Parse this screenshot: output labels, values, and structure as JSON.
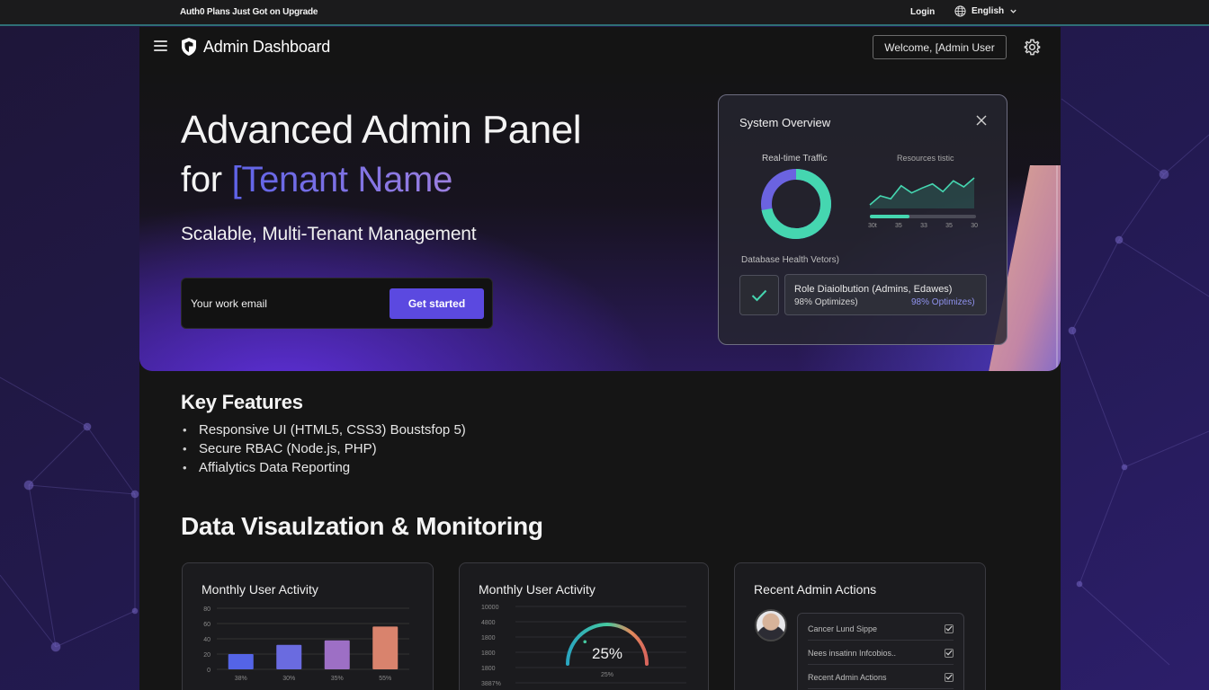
{
  "topbar": {
    "promo": "Auth0 Plans Just Got on Upgrade",
    "login": "Login",
    "language": "English",
    "icons": [
      "globe-icon",
      "chevron-down-icon"
    ]
  },
  "header": {
    "title": "Admin Dashboard",
    "welcome": "Welcome, [Admin User",
    "icons": [
      "hamburger-icon",
      "shield-logo-icon",
      "gear-icon"
    ]
  },
  "hero": {
    "title_line1": "Advanced Admin Panel",
    "title_prefix": "for ",
    "title_tenant": "[Tenant Name",
    "subtitle": "Scalable, Multi-Tenant Management",
    "email_placeholder": "Your work email",
    "cta": "Get started"
  },
  "overview": {
    "title": "System Overview",
    "traffic_label": "Real-time Traffic",
    "resources_label": "Resources tistic",
    "traffic_share": 0.72,
    "sparkline": [
      40,
      55,
      50,
      72,
      60,
      68,
      75,
      62,
      80,
      70,
      85
    ],
    "progress": 0.37,
    "ticks": [
      "30t",
      "35",
      "33",
      "35",
      "30"
    ],
    "db_label": "Database Health Vetors)",
    "role_title": "Role Diaiolbution (Admins, Edawes)",
    "role_stat_a": "98% Optimizes)",
    "role_stat_b": "98% Optimizes)",
    "accent": "#45d6b0",
    "donut_secondary": "#6b63e0"
  },
  "features": {
    "title": "Key Features",
    "items": [
      "Responsive UI (HTML5, CSS3) Boustsfop 5)",
      "Secure RBAC (Node.js, PHP)",
      "Affialytics Data Reporting"
    ]
  },
  "dataviz": {
    "title": "Data Visaulzation & Monitoring"
  },
  "cards": {
    "activity_bar": {
      "title": "Monthly User Activity",
      "chart_data": {
        "type": "bar",
        "categories": [
          "38%",
          "30%",
          "35%",
          "55%"
        ],
        "values": [
          20,
          32,
          38,
          56
        ],
        "yticks": [
          "80",
          "60",
          "40",
          "20",
          "0"
        ],
        "ylim": [
          0,
          80
        ],
        "colors": [
          "#5464e6",
          "#6a6be0",
          "#9d6fc5",
          "#d9836d"
        ]
      }
    },
    "activity_gauge": {
      "title": "Monthly User Activity",
      "yticks": [
        "10000",
        "4800",
        "1800",
        "1800",
        "1800",
        "3887%"
      ],
      "value_label": "25%",
      "sub_label": "25%",
      "value": 0.25
    },
    "admin_actions": {
      "title": "Recent Admin Actions",
      "rows": [
        "Cancer Lund Sippe",
        "Nees insatinn Infcobios..",
        "Recent Admin Actions"
      ]
    }
  }
}
